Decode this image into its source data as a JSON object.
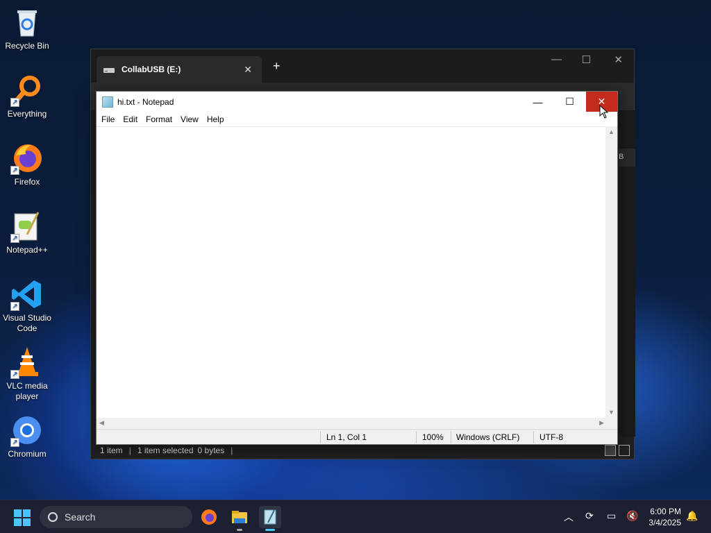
{
  "desktop": {
    "icons": [
      {
        "label": "Recycle Bin"
      },
      {
        "label": "Everything"
      },
      {
        "label": "Firefox"
      },
      {
        "label": "Notepad++"
      },
      {
        "label": "Visual Studio Code"
      },
      {
        "label": "VLC media player"
      },
      {
        "label": "Chromium"
      }
    ]
  },
  "explorer": {
    "tab_title": "CollabUSB (E:)",
    "tab_close": "✕",
    "new_tab": "+",
    "min": "—",
    "max": "☐",
    "close": "✕",
    "peek_letter": "B",
    "status": {
      "items": "1 item",
      "selected": "1 item selected",
      "size": "0 bytes",
      "sep": "|"
    }
  },
  "notepad": {
    "title": "hi.txt - Notepad",
    "controls": {
      "min": "—",
      "max": "☐",
      "close": "✕"
    },
    "menu": [
      "File",
      "Edit",
      "Format",
      "View",
      "Help"
    ],
    "content": "",
    "status": {
      "position": "Ln 1, Col 1",
      "zoom": "100%",
      "line_endings": "Windows (CRLF)",
      "encoding": "UTF-8"
    }
  },
  "taskbar": {
    "search_placeholder": "Search",
    "time": "6:00 PM",
    "date": "3/4/2025"
  },
  "colors": {
    "accent": "#4cc2ff",
    "close_red": "#c42b1c"
  }
}
